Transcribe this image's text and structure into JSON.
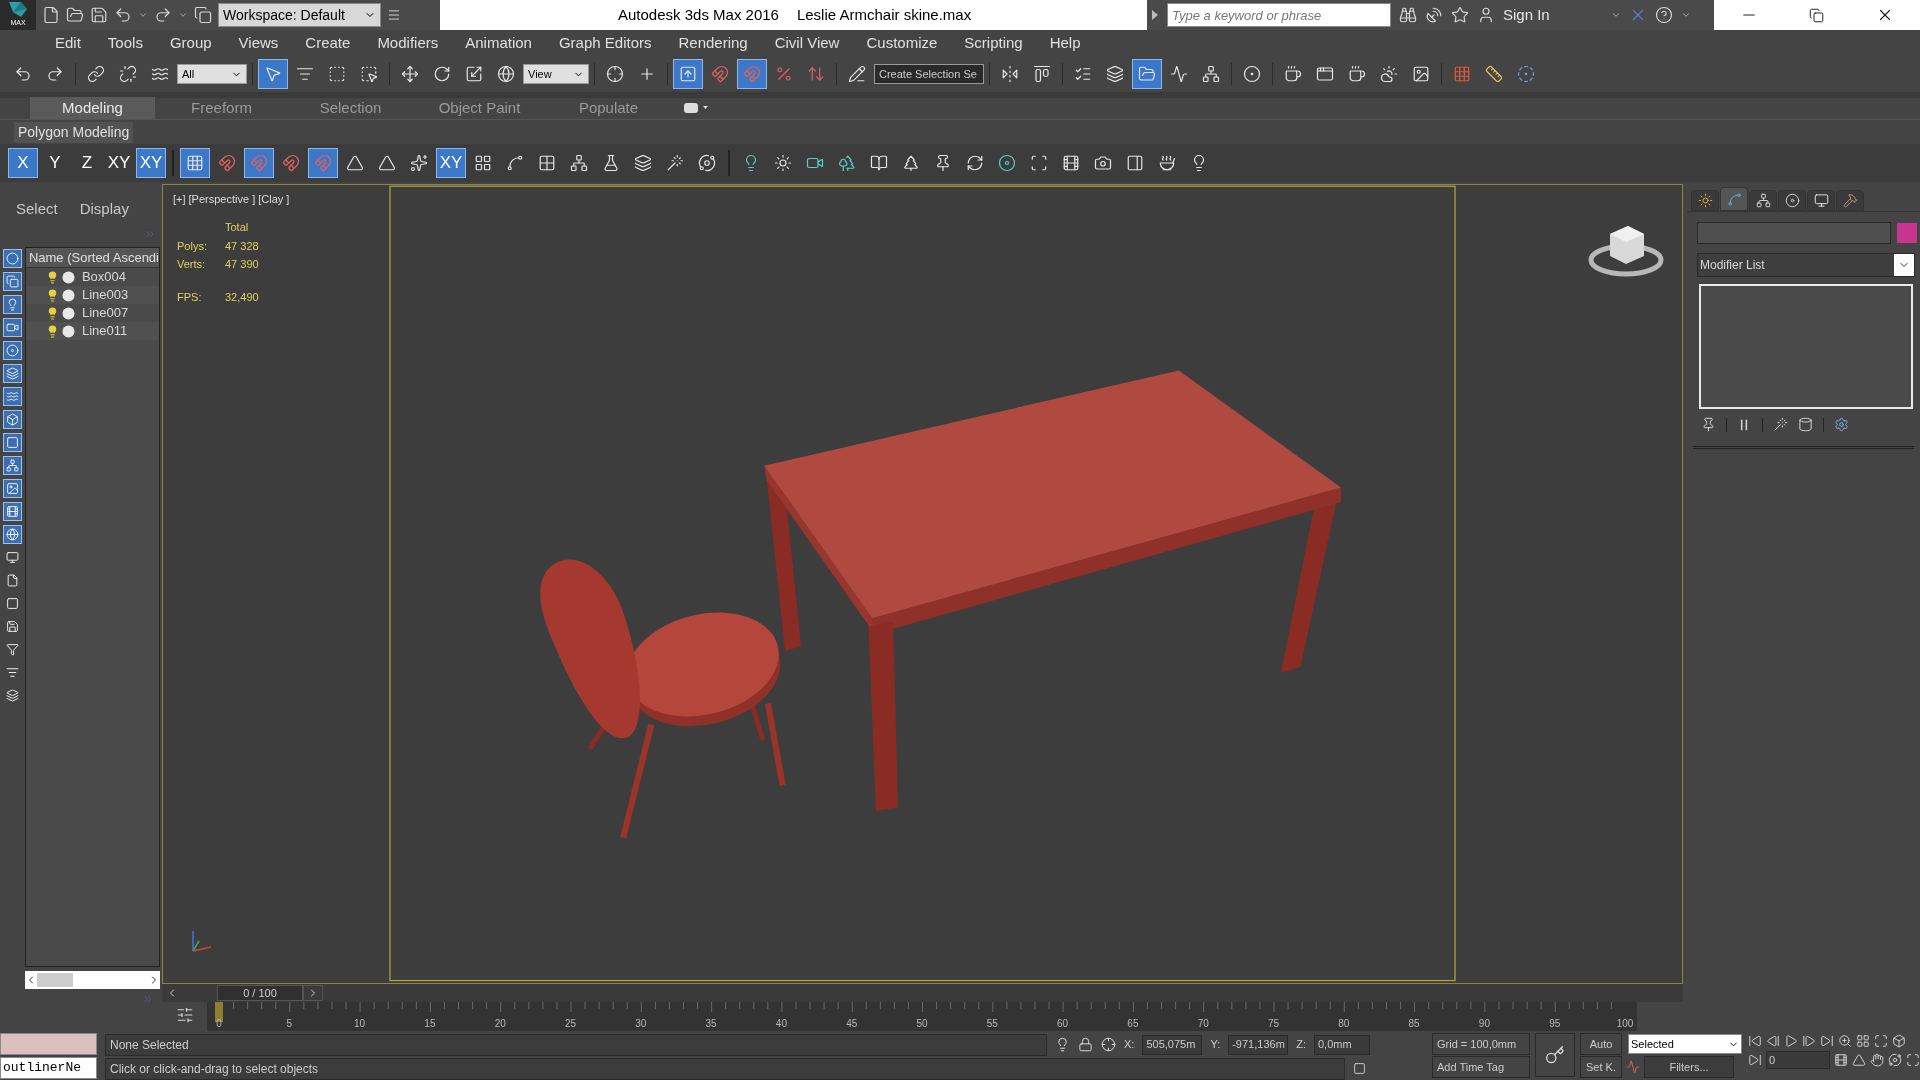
{
  "title_bar": {
    "app_button": "MAX",
    "workspace": "Workspace: Default",
    "app_title": "Autodesk 3ds Max 2016",
    "file_name": "Leslie Armchair skine.max",
    "search": {
      "placeholder": "Type a keyword or phrase"
    },
    "sign_in": "Sign In"
  },
  "menu_bar": [
    "Edit",
    "Tools",
    "Group",
    "Views",
    "Create",
    "Modifiers",
    "Animation",
    "Graph Editors",
    "Rendering",
    "Civil View",
    "Customize",
    "Scripting",
    "Help"
  ],
  "main_toolbar": [
    {
      "kind": "button",
      "on": false
    },
    {
      "kind": "button",
      "on": false
    },
    {
      "kind": "button",
      "on": false
    },
    {
      "kind": "button",
      "on": false
    },
    {
      "kind": "button",
      "on": false
    },
    {
      "kind": "dropdown",
      "value": "All"
    },
    {
      "kind": "button",
      "on": true
    },
    {
      "kind": "button",
      "on": false
    },
    {
      "kind": "button",
      "on": false
    },
    {
      "kind": "button",
      "on": false
    },
    {
      "kind": "button",
      "on": false
    },
    {
      "kind": "button",
      "on": false
    },
    {
      "kind": "button",
      "on": false
    },
    {
      "kind": "button",
      "on": false
    },
    {
      "kind": "dropdown",
      "value": "View"
    },
    {
      "kind": "button",
      "on": false
    },
    {
      "kind": "button",
      "on": false
    },
    {
      "kind": "button",
      "on": true
    },
    {
      "kind": "button",
      "on": false
    },
    {
      "kind": "button",
      "on": true
    },
    {
      "kind": "button",
      "on": false
    },
    {
      "kind": "button",
      "on": false
    },
    {
      "kind": "button",
      "on": false
    },
    {
      "kind": "dropdown",
      "value": "Create Selection Se"
    },
    {
      "kind": "button",
      "on": false
    },
    {
      "kind": "button",
      "on": false
    },
    {
      "kind": "button",
      "on": false
    },
    {
      "kind": "button",
      "on": false
    },
    {
      "kind": "button",
      "on": true
    },
    {
      "kind": "button",
      "on": false
    },
    {
      "kind": "button",
      "on": false
    },
    {
      "kind": "button",
      "on": false
    },
    {
      "kind": "button",
      "on": false
    },
    {
      "kind": "button",
      "on": false
    },
    {
      "kind": "button",
      "on": false
    },
    {
      "kind": "button",
      "on": false
    },
    {
      "kind": "button",
      "on": false
    },
    {
      "kind": "button",
      "on": false
    },
    {
      "kind": "button",
      "on": false
    },
    {
      "kind": "button",
      "on": false
    }
  ],
  "ribbon": {
    "tabs": [
      {
        "label": "Modeling",
        "selected": true
      },
      {
        "label": "Freeform",
        "selected": false
      },
      {
        "label": "Selection",
        "selected": false
      },
      {
        "label": "Object Paint",
        "selected": false
      },
      {
        "label": "Populate",
        "selected": false
      }
    ],
    "panel_label": "Polygon Modeling",
    "tools": [
      {
        "kind": "text",
        "label": "X",
        "on": true
      },
      {
        "kind": "text",
        "label": "Y",
        "on": false
      },
      {
        "kind": "text",
        "label": "Z",
        "on": false
      },
      {
        "kind": "text",
        "label": "XY",
        "on": false
      },
      {
        "kind": "text",
        "label": "XY",
        "on": true
      },
      {
        "kind": "icon",
        "on": true
      },
      {
        "kind": "icon",
        "on": false
      },
      {
        "kind": "icon",
        "on": true
      },
      {
        "kind": "icon",
        "on": false
      },
      {
        "kind": "icon",
        "on": true
      },
      {
        "kind": "icon",
        "on": false
      },
      {
        "kind": "icon",
        "on": false
      },
      {
        "kind": "icon",
        "on": false
      },
      {
        "kind": "text",
        "label": "XY",
        "on": true
      },
      {
        "kind": "icon",
        "on": false
      },
      {
        "kind": "icon",
        "on": false
      },
      {
        "kind": "icon",
        "on": false
      },
      {
        "kind": "icon",
        "on": false
      },
      {
        "kind": "icon",
        "on": false
      },
      {
        "kind": "icon",
        "on": false
      },
      {
        "kind": "icon",
        "on": false
      },
      {
        "kind": "icon",
        "on": false
      },
      {
        "kind": "icon",
        "on": false
      },
      {
        "kind": "icon",
        "on": false
      },
      {
        "kind": "icon",
        "on": false
      },
      {
        "kind": "icon",
        "on": false
      },
      {
        "kind": "icon",
        "on": false
      },
      {
        "kind": "icon",
        "on": false
      },
      {
        "kind": "icon",
        "on": false
      },
      {
        "kind": "icon",
        "on": false
      },
      {
        "kind": "icon",
        "on": false
      },
      {
        "kind": "icon",
        "on": false
      },
      {
        "kind": "icon",
        "on": false
      },
      {
        "kind": "icon",
        "on": false
      },
      {
        "kind": "icon",
        "on": false
      },
      {
        "kind": "icon",
        "on": false
      },
      {
        "kind": "icon",
        "on": false
      }
    ]
  },
  "scene_explorer": {
    "tabs": [
      {
        "label": "Select",
        "selected": false
      },
      {
        "label": "Display",
        "selected": false
      }
    ],
    "column": "Name (Sorted Ascendi",
    "objects": [
      "Box004",
      "Line003",
      "Line007",
      "Line011"
    ]
  },
  "viewport": {
    "labels": [
      "[+]",
      "[Perspective ]",
      "[Clay ]"
    ],
    "stats": {
      "header": "Total",
      "rows": [
        {
          "label": "Polys:",
          "value": "47 328"
        },
        {
          "label": "Verts:",
          "value": "47 390"
        }
      ],
      "fps": {
        "label": "FPS:",
        "value": "32,490"
      }
    }
  },
  "command_panel": {
    "tabs": [
      {
        "selected": false
      },
      {
        "selected": true
      },
      {
        "selected": false
      },
      {
        "selected": false
      },
      {
        "selected": false
      },
      {
        "selected": false
      }
    ],
    "modifier_list": "Modifier List"
  },
  "time_slider": {
    "position": "0 / 100",
    "ticks": [
      "0",
      "5",
      "10",
      "15",
      "20",
      "25",
      "30",
      "35",
      "40",
      "45",
      "50",
      "55",
      "60",
      "65",
      "70",
      "75",
      "80",
      "85",
      "90",
      "95",
      "100"
    ]
  },
  "status_bar": {
    "script_field": "outlinerNe",
    "selection": "None Selected",
    "prompt": "Click or click-and-drag to select objects",
    "x_label": "X:",
    "x_value": "505,075m",
    "y_label": "Y:",
    "y_value": "-971,136m",
    "z_label": "Z:",
    "z_value": "0,0mm",
    "grid": "Grid = 100,0mm",
    "add_time_tag": "Add Time Tag",
    "auto_key": "Auto",
    "set_key": "Set K.",
    "key_filter": "Selected",
    "filters": "Filters...",
    "frame": "0"
  }
}
